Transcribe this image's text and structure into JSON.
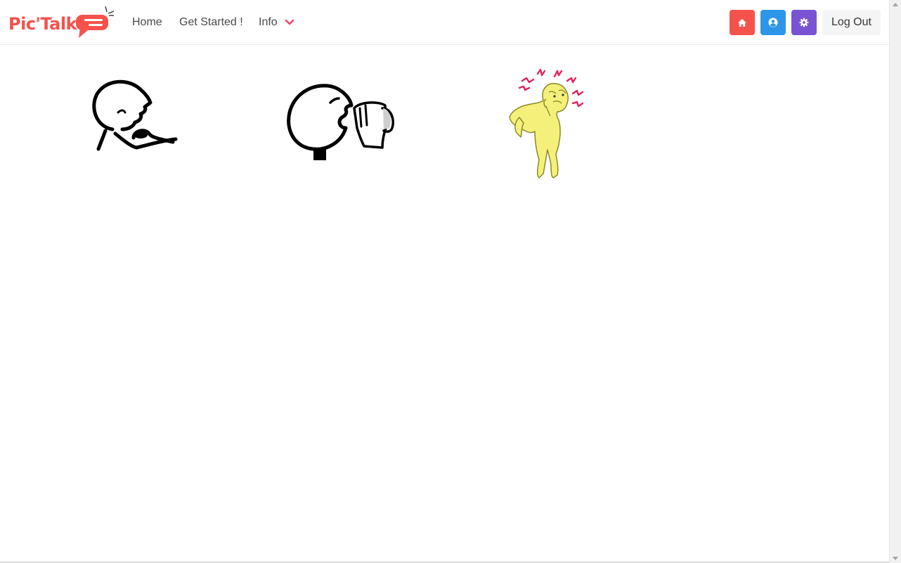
{
  "brand": {
    "name": "Pic'Talk",
    "color": "#f4524b"
  },
  "nav": {
    "home_label": "Home",
    "get_started_label": "Get Started !",
    "info_label": "Info",
    "info_icon": "chevron-down-icon"
  },
  "actions": {
    "home_button_icon": "home-icon",
    "home_button_color": "#f14668",
    "profile_button_icon": "user-circle-icon",
    "profile_button_color": "#2e96e8",
    "settings_button_icon": "gear-icon",
    "settings_button_color": "#7a52d4",
    "logout_label": "Log Out"
  },
  "pictograms": [
    {
      "name": "eat",
      "icon": "person-eating-icon"
    },
    {
      "name": "drink",
      "icon": "person-drinking-icon"
    },
    {
      "name": "pain",
      "icon": "person-in-pain-icon"
    }
  ]
}
